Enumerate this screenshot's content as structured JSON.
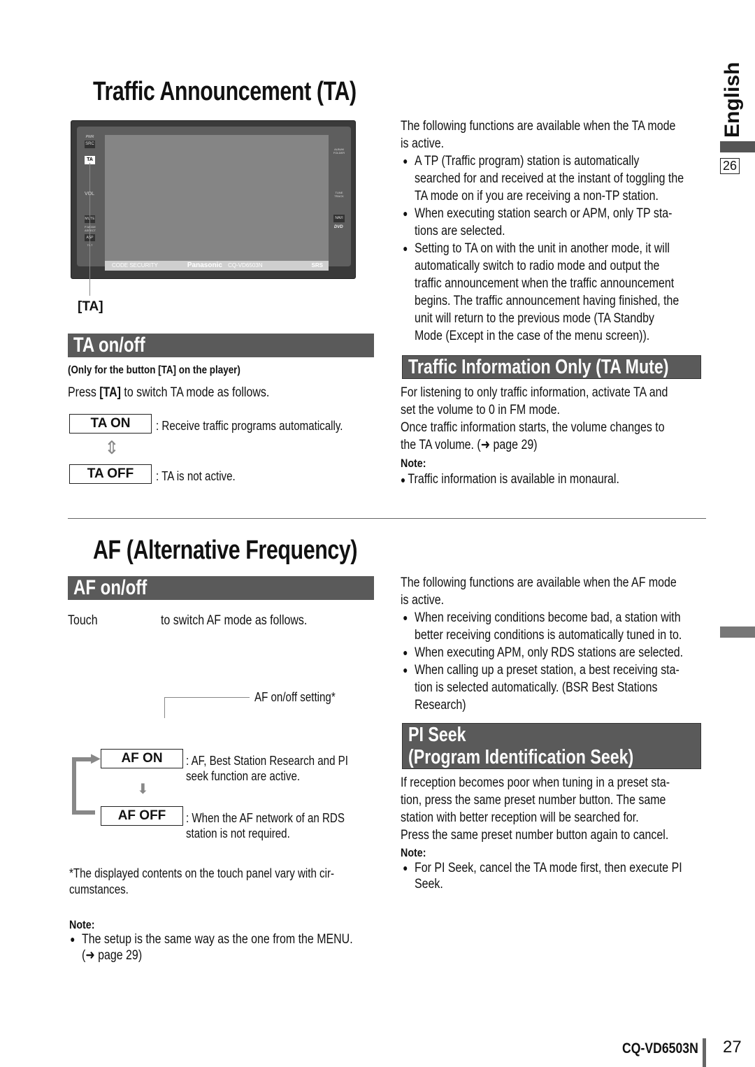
{
  "side": {
    "language": "English",
    "page_left": "26"
  },
  "ta": {
    "title": "Traffic Announcement  (TA)",
    "device": {
      "pwr": "PWR",
      "src": "SRC",
      "ta": "TA",
      "vol": "VOL",
      "mute": "MUTE",
      "pmode": "P-MODE ASPECT",
      "asp": "ASP",
      "tilt": "TILT",
      "album": "ALBUM FOLDER",
      "tune": "TUNE TRACK",
      "navi": "NAVI",
      "dvd": "DVD",
      "code": "CODE SECURITY",
      "brand": "Panasonic",
      "model": "CQ-VD6503N",
      "srs": "SRS"
    },
    "callout": "[TA]",
    "intro": [
      "The following functions are available when the TA mode",
      "is active."
    ],
    "bullets": [
      [
        "A TP (Traffic program) station is automatically",
        "searched for and received at the instant of toggling the",
        "TA mode on if you are receiving a non-TP station."
      ],
      [
        "When executing station search or APM, only TP sta-",
        "tions are selected."
      ],
      [
        "Setting to TA on with the unit in another mode, it will",
        "automatically switch to radio mode and output the",
        "traffic announcement when the traffic announcement",
        "begins. The traffic announcement having finished, the",
        "unit will return to the previous mode (TA Standby",
        "Mode (Except in the case of the menu screen))."
      ]
    ],
    "onoff": {
      "heading": "TA on/off",
      "sub": "(Only for the button [TA] on the player)",
      "press": "Press ",
      "press_key": "[TA]",
      "press_rest": " to switch TA mode as follows.",
      "on": "TA ON",
      "on_desc": ": Receive traffic programs automatically.",
      "off": "TA OFF",
      "off_desc": ": TA is not active."
    },
    "mute": {
      "heading": "Traffic Information Only (TA Mute)",
      "lines": [
        "For listening to only traffic information, activate TA and",
        "set the volume to 0 in FM mode.",
        "Once traffic information starts, the volume changes to",
        "the TA volume. (➜ page 29)"
      ],
      "note_label": "Note:",
      "note": "Traffic information is available in monaural."
    }
  },
  "af": {
    "title": "AF (Alternative Frequency)",
    "onoff": {
      "heading": "AF on/off",
      "touch": "Touch",
      "touch_rest": "to switch AF mode as follows.",
      "setting": "AF on/off setting*",
      "on": "AF ON",
      "on_desc": [
        ": AF, Best Station Research and PI",
        "seek function are active."
      ],
      "off": "AF OFF",
      "off_desc": [
        ": When the AF network of an RDS",
        "station is not required."
      ],
      "footnote": [
        "*The displayed contents on the touch panel vary with cir-",
        "cumstances."
      ],
      "note_label": "Note:",
      "note": [
        "The setup is the same way as the one from the MENU.",
        "(➜ page 29)"
      ]
    },
    "intro": [
      "The following functions are available when the AF mode",
      "is active."
    ],
    "bullets": [
      [
        "When receiving conditions become bad, a station with",
        "better receiving conditions is automatically tuned in to."
      ],
      [
        "When executing APM, only RDS stations are selected."
      ],
      [
        "When calling up a preset station, a best receiving sta-",
        "tion is selected automatically. (BSR Best Stations",
        "Research)"
      ]
    ],
    "pi": {
      "heading1": "PI Seek",
      "heading2": "(Program Identification Seek)",
      "lines": [
        "If reception becomes poor when tuning in a preset sta-",
        "tion, press the same preset number button. The same",
        "station with better reception will be searched for.",
        "Press the same preset number button again to cancel."
      ],
      "note_label": "Note:",
      "note": [
        "For PI Seek, cancel the TA mode first, then execute PI",
        "Seek."
      ]
    }
  },
  "footer": {
    "model": "CQ-VD6503N",
    "page": "27"
  }
}
